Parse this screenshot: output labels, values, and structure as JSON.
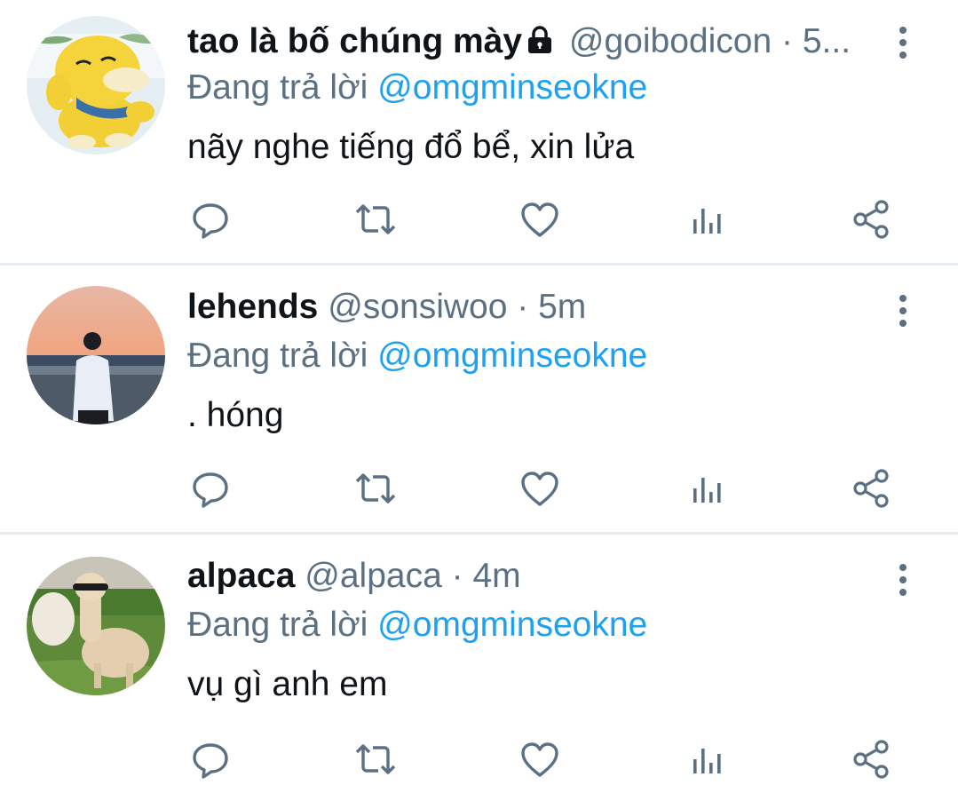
{
  "reply_prefix": "Đang trả lời",
  "colors": {
    "name": "#0f1419",
    "secondary": "#5b7083",
    "mention": "#1da1f2",
    "divider": "#e6ecf0"
  },
  "icons": [
    "more-vertical-icon",
    "reply-icon",
    "retweet-icon",
    "like-icon",
    "analytics-icon",
    "share-icon",
    "lock-icon"
  ],
  "tweets": [
    {
      "name": "tao là bố chúng mày",
      "protected": true,
      "handle": "@goibodicon",
      "separator": "·",
      "time": "5...",
      "reply_to": "@omgminseokne",
      "text": "nãy nghe tiếng đổ bể, xin lửa"
    },
    {
      "name": "lehends",
      "protected": false,
      "handle": "@sonsiwoo",
      "separator": "·",
      "time": "5m",
      "reply_to": "@omgminseokne",
      "text": ". hóng"
    },
    {
      "name": "alpaca",
      "protected": false,
      "handle": "@alpaca",
      "separator": "·",
      "time": "4m",
      "reply_to": "@omgminseokne",
      "text": "vụ gì anh em"
    }
  ]
}
